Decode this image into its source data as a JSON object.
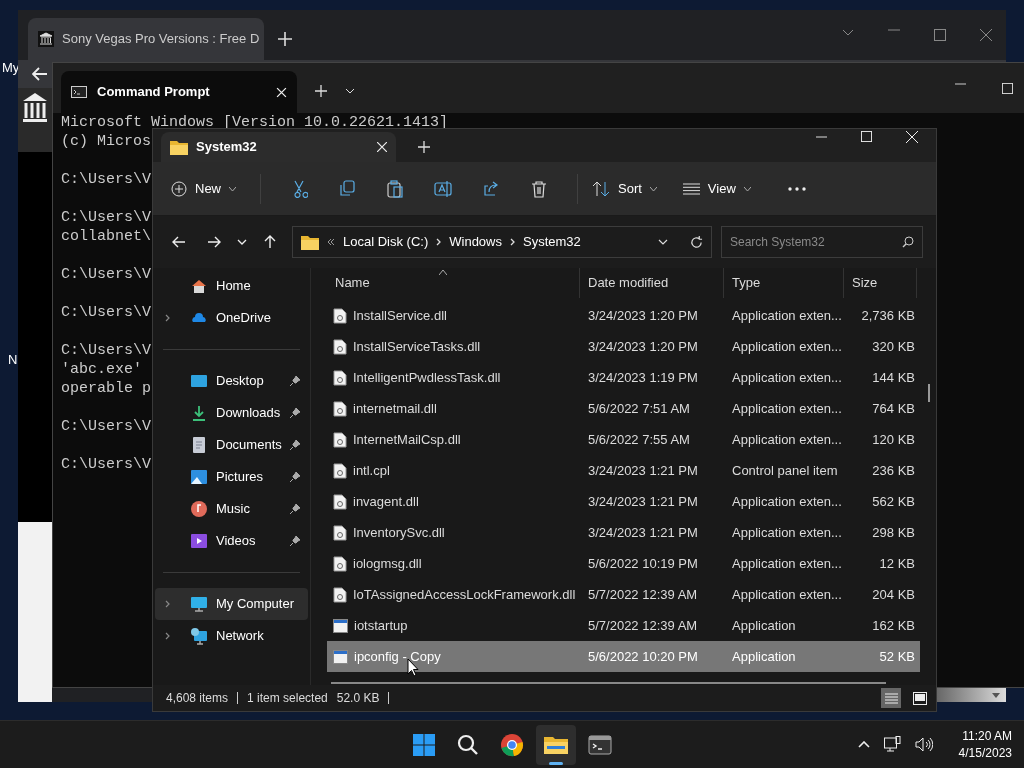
{
  "desktop": {
    "icons": [
      {
        "label": "My"
      },
      {
        "label": "N"
      }
    ]
  },
  "browser": {
    "tab": {
      "title": "Sony Vegas Pro Versions : Free D"
    }
  },
  "cmd": {
    "title": "Command Prompt",
    "blocks": [
      [
        "Microsoft Windows [Version 10.0.22621.1413]",
        "(c) Micros"
      ],
      [
        "C:\\Users\\V"
      ],
      [
        "C:\\Users\\V",
        "collabnet\\"
      ],
      [
        "C:\\Users\\V"
      ],
      [
        "C:\\Users\\V"
      ],
      [
        "C:\\Users\\V",
        "'abc.exe'",
        "operable p"
      ],
      [
        "C:\\Users\\V"
      ],
      [
        "C:\\Users\\V"
      ]
    ]
  },
  "explorer": {
    "tab_title": "System32",
    "toolbar": {
      "new_label": "New",
      "sort_label": "Sort",
      "view_label": "View"
    },
    "address": {
      "segments": [
        "Local Disk (C:)",
        "Windows",
        "System32"
      ]
    },
    "search": {
      "placeholder": "Search System32"
    },
    "nav_groups": [
      [
        {
          "label": "Home",
          "kind": "home",
          "expandable": false,
          "pinned": false,
          "selected": false
        },
        {
          "label": "OneDrive",
          "kind": "cloud",
          "expandable": true,
          "pinned": false,
          "selected": false
        }
      ],
      [
        {
          "label": "Desktop",
          "kind": "desktop",
          "expandable": false,
          "pinned": true,
          "selected": false
        },
        {
          "label": "Downloads",
          "kind": "download",
          "expandable": false,
          "pinned": true,
          "selected": false
        },
        {
          "label": "Documents",
          "kind": "document",
          "expandable": false,
          "pinned": true,
          "selected": false
        },
        {
          "label": "Pictures",
          "kind": "picture",
          "expandable": false,
          "pinned": true,
          "selected": false
        },
        {
          "label": "Music",
          "kind": "music",
          "expandable": false,
          "pinned": true,
          "selected": false
        },
        {
          "label": "Videos",
          "kind": "video",
          "expandable": false,
          "pinned": true,
          "selected": false
        }
      ],
      [
        {
          "label": "My Computer",
          "kind": "computer",
          "expandable": true,
          "pinned": false,
          "selected": true
        },
        {
          "label": "Network",
          "kind": "network",
          "expandable": true,
          "pinned": false,
          "selected": false
        }
      ]
    ],
    "columns": [
      "Name",
      "Date modified",
      "Type",
      "Size"
    ],
    "rows": [
      {
        "name": "InstallService.dll",
        "kind": "dll",
        "date": "3/24/2023 1:20 PM",
        "type": "Application exten...",
        "size": "2,736 KB",
        "selected": false
      },
      {
        "name": "InstallServiceTasks.dll",
        "kind": "dll",
        "date": "3/24/2023 1:20 PM",
        "type": "Application exten...",
        "size": "320 KB",
        "selected": false
      },
      {
        "name": "IntelligentPwdlessTask.dll",
        "kind": "dll",
        "date": "3/24/2023 1:19 PM",
        "type": "Application exten...",
        "size": "144 KB",
        "selected": false
      },
      {
        "name": "internetmail.dll",
        "kind": "dll",
        "date": "5/6/2022 7:51 AM",
        "type": "Application exten...",
        "size": "764 KB",
        "selected": false
      },
      {
        "name": "InternetMailCsp.dll",
        "kind": "dll",
        "date": "5/6/2022 7:55 AM",
        "type": "Application exten...",
        "size": "120 KB",
        "selected": false
      },
      {
        "name": "intl.cpl",
        "kind": "dll",
        "date": "3/24/2023 1:21 PM",
        "type": "Control panel item",
        "size": "236 KB",
        "selected": false
      },
      {
        "name": "invagent.dll",
        "kind": "dll",
        "date": "3/24/2023 1:21 PM",
        "type": "Application exten...",
        "size": "562 KB",
        "selected": false
      },
      {
        "name": "InventorySvc.dll",
        "kind": "dll",
        "date": "3/24/2023 1:21 PM",
        "type": "Application exten...",
        "size": "298 KB",
        "selected": false
      },
      {
        "name": "iologmsg.dll",
        "kind": "dll",
        "date": "5/6/2022 10:19 PM",
        "type": "Application exten...",
        "size": "12 KB",
        "selected": false
      },
      {
        "name": "IoTAssignedAccessLockFramework.dll",
        "kind": "dll",
        "date": "5/7/2022 12:39 AM",
        "type": "Application exten...",
        "size": "204 KB",
        "selected": false
      },
      {
        "name": "iotstartup",
        "kind": "app",
        "date": "5/7/2022 12:39 AM",
        "type": "Application",
        "size": "162 KB",
        "selected": false
      },
      {
        "name": "ipconfig - Copy",
        "kind": "app",
        "date": "5/6/2022 10:20 PM",
        "type": "Application",
        "size": "52 KB",
        "selected": true
      }
    ],
    "status": {
      "count": "4,608 items",
      "selection": "1 item selected",
      "selection_size": "52.0 KB"
    },
    "view_modes": [
      {
        "kind": "details",
        "selected": true
      },
      {
        "kind": "tiles",
        "selected": false
      }
    ]
  },
  "taskbar": {
    "apps": [
      {
        "kind": "start",
        "active": false
      },
      {
        "kind": "search",
        "active": false
      },
      {
        "kind": "chrome",
        "active": false
      },
      {
        "kind": "explorer",
        "active": true
      },
      {
        "kind": "terminal",
        "active": false
      }
    ],
    "clock": {
      "time": "11:20 AM",
      "date": "4/15/2023"
    }
  }
}
